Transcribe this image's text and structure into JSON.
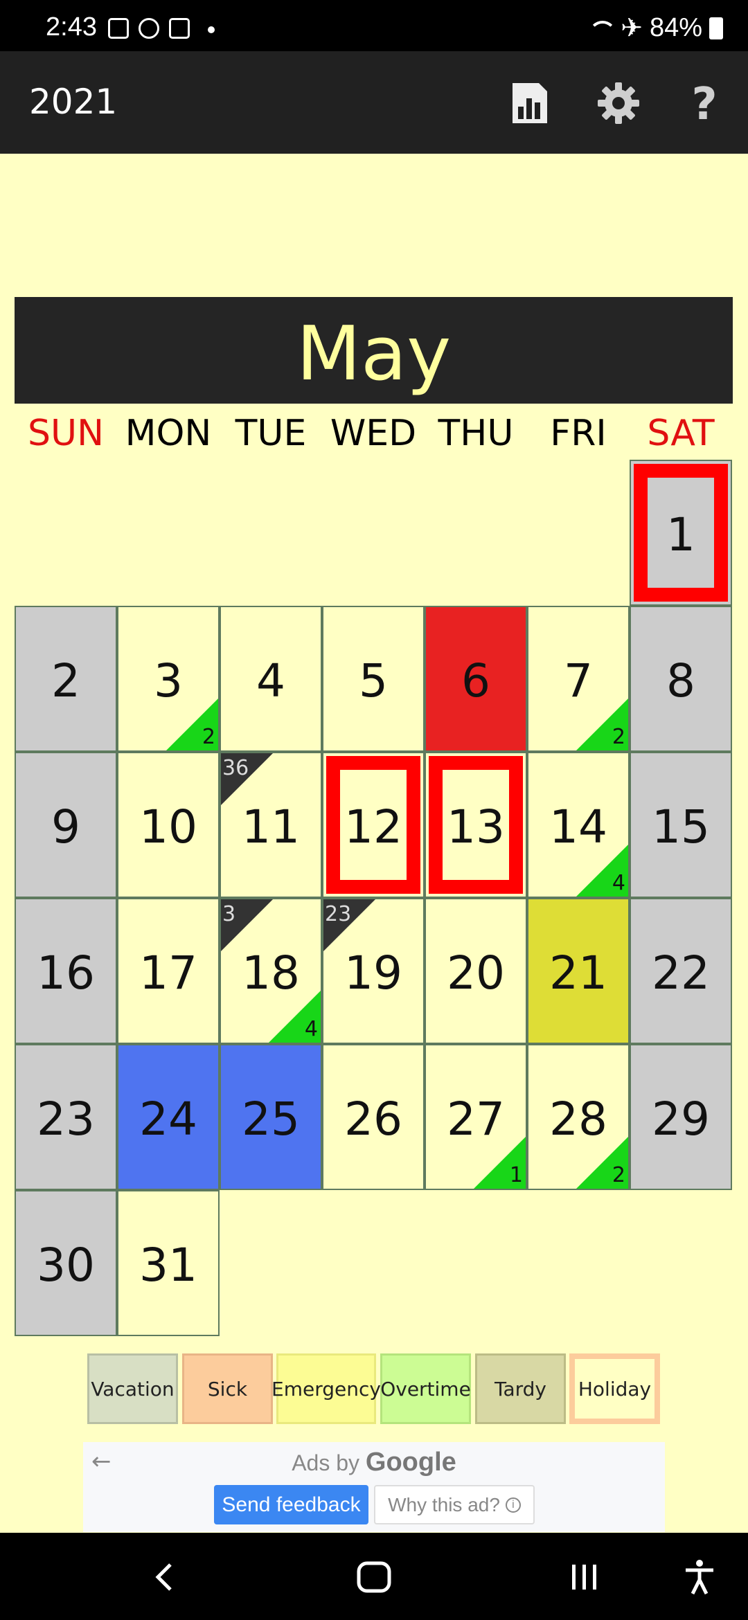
{
  "status_bar": {
    "time": "2:43",
    "battery": "84%",
    "icons": [
      "gallery-icon",
      "viber-icon",
      "calendar-icon",
      "dot-icon",
      "wifi-icon",
      "airplane-icon",
      "battery-icon"
    ]
  },
  "app_bar": {
    "title": "2021",
    "actions": [
      "stats-icon",
      "settings-icon",
      "help-icon"
    ]
  },
  "calendar": {
    "month": "May",
    "weekdays": [
      "SUN",
      "MON",
      "TUE",
      "WED",
      "THU",
      "FRI",
      "SAT"
    ],
    "weekend_color": "#e01010",
    "days": [
      {
        "n": "1"
      },
      {
        "n": "2"
      },
      {
        "n": "3",
        "br": "2"
      },
      {
        "n": "4"
      },
      {
        "n": "5"
      },
      {
        "n": "6"
      },
      {
        "n": "7",
        "br": "2"
      },
      {
        "n": "8"
      },
      {
        "n": "9"
      },
      {
        "n": "10"
      },
      {
        "n": "11",
        "tl": "36"
      },
      {
        "n": "12"
      },
      {
        "n": "13"
      },
      {
        "n": "14",
        "br": "4"
      },
      {
        "n": "15"
      },
      {
        "n": "16"
      },
      {
        "n": "17"
      },
      {
        "n": "18",
        "tl": "3",
        "br": "4"
      },
      {
        "n": "19",
        "tl": "23"
      },
      {
        "n": "20"
      },
      {
        "n": "21"
      },
      {
        "n": "22"
      },
      {
        "n": "23"
      },
      {
        "n": "24"
      },
      {
        "n": "25"
      },
      {
        "n": "26"
      },
      {
        "n": "27",
        "br": "1"
      },
      {
        "n": "28",
        "br": "2"
      },
      {
        "n": "29"
      },
      {
        "n": "30"
      },
      {
        "n": "31"
      }
    ]
  },
  "legend": {
    "vacation": "Vacation",
    "sick": "Sick",
    "emergency": "Emergency",
    "overtime": "Overtime",
    "tardy": "Tardy",
    "holiday": "Holiday"
  },
  "ad": {
    "ads_by": "Ads by",
    "brand": "Google",
    "send_feedback": "Send feedback",
    "why_this_ad": "Why this ad?"
  },
  "colors": {
    "background": "#ffffc4",
    "weekend": "#cccccc",
    "holiday_border": "#ff0000",
    "sick_day": "#e82222",
    "tardy_day": "#dedd36",
    "vacation_day": "#4f74f0",
    "overtime_marker": "#18d618",
    "dark_marker": "#333333"
  }
}
